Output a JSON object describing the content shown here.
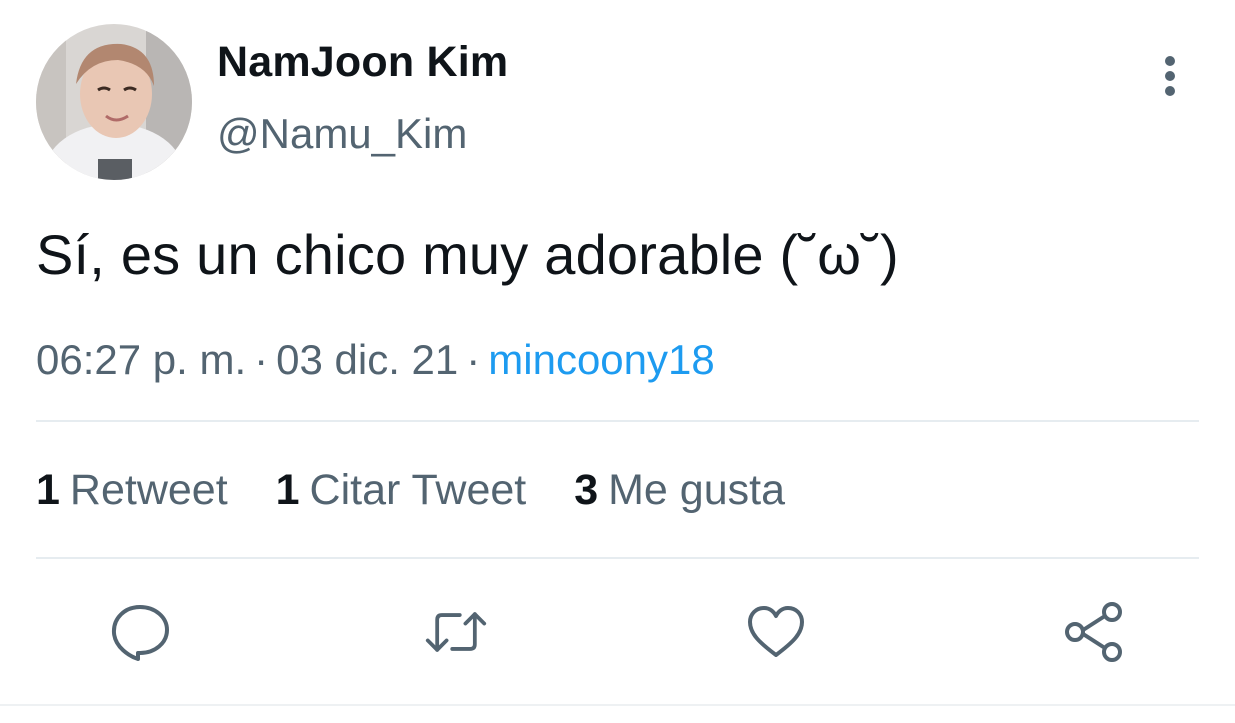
{
  "tweet": {
    "display_name": "NamJoon Kim",
    "handle": "@Namu_Kim",
    "text": "Sí, es un chico muy adorable (˘ω˘)",
    "time": "06:27 p. m.",
    "separator": "·",
    "date": "03 dic. 21",
    "source": "mincoony18"
  },
  "stats": {
    "retweets": {
      "count": "1",
      "label": "Retweet"
    },
    "quotes": {
      "count": "1",
      "label": "Citar Tweet"
    },
    "likes": {
      "count": "3",
      "label": "Me gusta"
    }
  },
  "actions": {
    "reply_icon": "speech-bubble",
    "retweet_icon": "retweet-arrows",
    "like_icon": "heart-outline",
    "share_icon": "share-nodes"
  },
  "colors": {
    "text_primary": "#0f1419",
    "text_secondary": "#536471",
    "link": "#1d9bf0",
    "divider": "#e6ecf0"
  }
}
